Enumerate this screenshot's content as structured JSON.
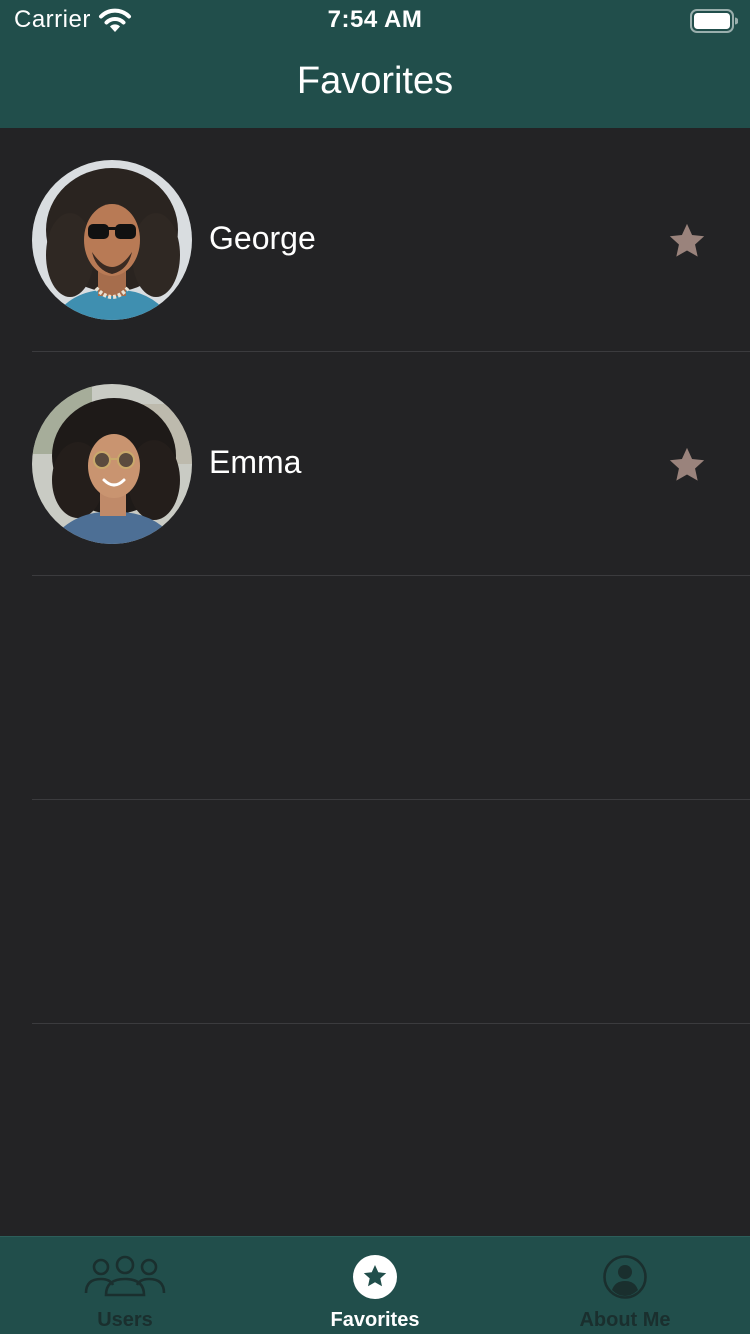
{
  "status_bar": {
    "carrier": "Carrier",
    "time": "7:54 AM",
    "icons": [
      "wifi-icon",
      "battery-icon"
    ]
  },
  "nav": {
    "title": "Favorites"
  },
  "colors": {
    "header_bg": "#214e4b",
    "list_bg": "#232325",
    "star": "#9a837c",
    "tab_inactive": "#1a2f2e",
    "tab_active": "#ffffff"
  },
  "favorites": [
    {
      "name": "George",
      "avatar": "avatar-photo",
      "star_icon": "star-icon"
    },
    {
      "name": "Emma",
      "avatar": "avatar-photo",
      "star_icon": "star-icon"
    }
  ],
  "tabs": [
    {
      "label": "Users",
      "icon": "users-icon",
      "active": false
    },
    {
      "label": "Favorites",
      "icon": "star-circle-icon",
      "active": true
    },
    {
      "label": "About Me",
      "icon": "person-circle-icon",
      "active": false
    }
  ]
}
